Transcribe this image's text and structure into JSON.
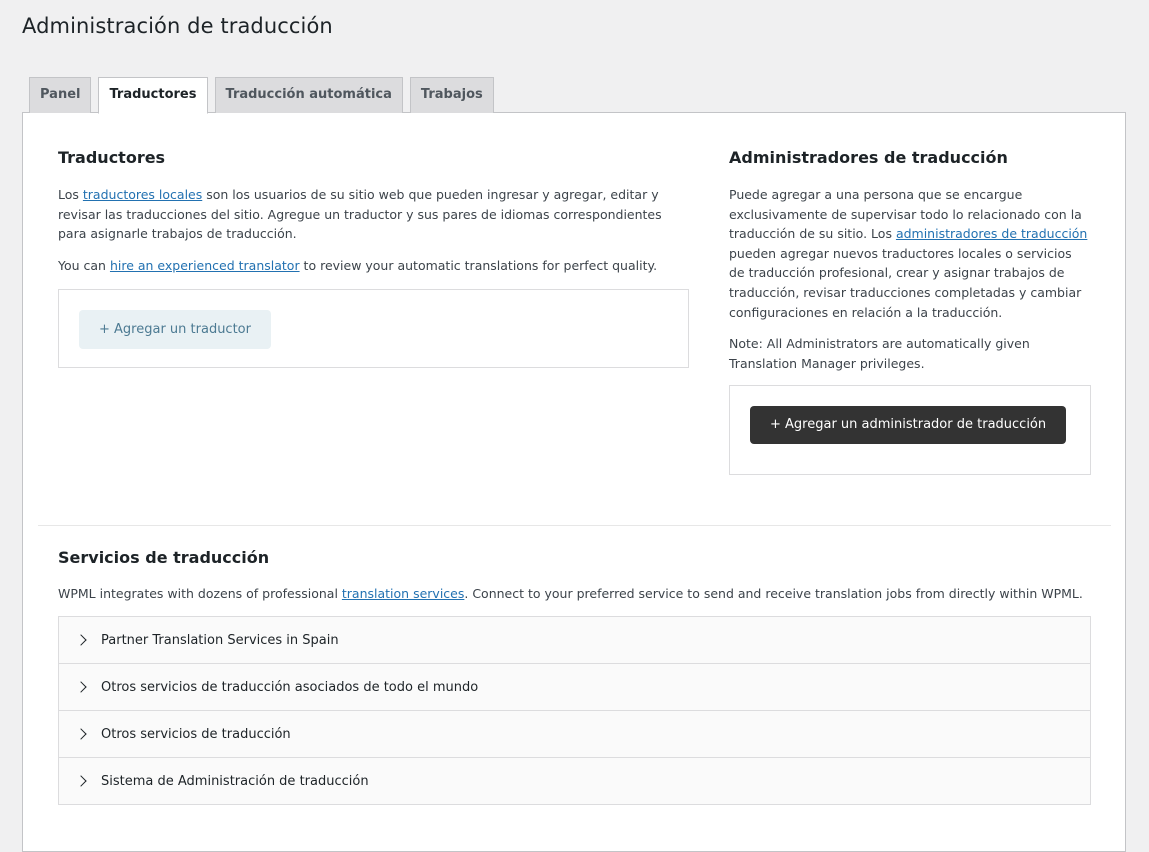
{
  "page": {
    "title": "Administración de traducción"
  },
  "tabs": [
    {
      "label": "Panel",
      "active": false
    },
    {
      "label": "Traductores",
      "active": true
    },
    {
      "label": "Traducción automática",
      "active": false
    },
    {
      "label": "Trabajos",
      "active": false
    }
  ],
  "translators": {
    "title": "Traductores",
    "intro_before": "Los ",
    "intro_link": "traductores locales",
    "intro_after": " son los usuarios de su sitio web que pueden ingresar y agregar, editar y revisar las traducciones del sitio. Agregue un traductor y sus pares de idiomas correspondientes para asignarle trabajos de traducción.",
    "hire_before": "You can ",
    "hire_link": "hire an experienced translator",
    "hire_after": " to review your automatic translations for perfect quality.",
    "add_button": "+ Agregar un traductor"
  },
  "managers": {
    "title": "Administradores de traducción",
    "desc_before": "Puede agregar a una persona que se encargue exclusivamente de supervisar todo lo relacionado con la traducción de su sitio. Los ",
    "desc_link": "administradores de traducción",
    "desc_after": " pueden agregar nuevos traductores locales o servicios de traducción profesional, crear y asignar trabajos de traducción, revisar traducciones completadas y cambiar configuraciones en relación a la traducción.",
    "note": "Note: All Administrators are automatically given Translation Manager privileges.",
    "add_button": "+ Agregar un administrador de traducción"
  },
  "services": {
    "title": "Servicios de traducción",
    "desc_before": "WPML integrates with dozens of professional ",
    "desc_link": "translation services",
    "desc_after": ". Connect to your preferred service to send and receive translation jobs from directly within WPML.",
    "items": [
      {
        "label": "Partner Translation Services in Spain"
      },
      {
        "label": "Otros servicios de traducción asociados de todo el mundo"
      },
      {
        "label": "Otros servicios de traducción"
      },
      {
        "label": "Sistema de Administración de traducción"
      }
    ]
  },
  "colors": {
    "background": "#f0f0f1",
    "link": "#2271b1",
    "dark_button": "#333333",
    "light_button": "#e9f1f4"
  },
  "icons": {
    "accordion_toggle": "chevron-right-icon"
  }
}
